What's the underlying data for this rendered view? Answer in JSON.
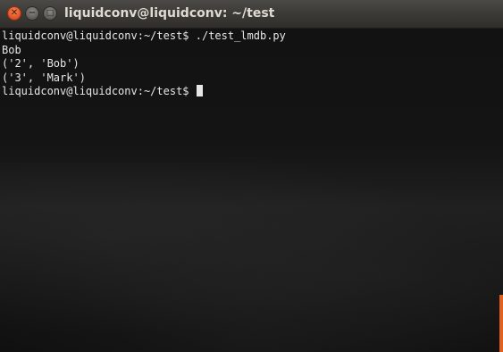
{
  "window": {
    "title": "liquidconv@liquidconv: ~/test",
    "buttons": {
      "close_glyph": "✕",
      "minimize_glyph": "−",
      "maximize_glyph": "□"
    }
  },
  "terminal": {
    "lines": [
      "liquidconv@liquidconv:~/test$ ./test_lmdb.py",
      "Bob",
      "('2', 'Bob')",
      "('3', 'Mark')",
      "liquidconv@liquidconv:~/test$ "
    ]
  },
  "colors": {
    "close_button": "#e4562a",
    "scrollbar": "#e2611f",
    "titlebar": "#3c3b37"
  }
}
